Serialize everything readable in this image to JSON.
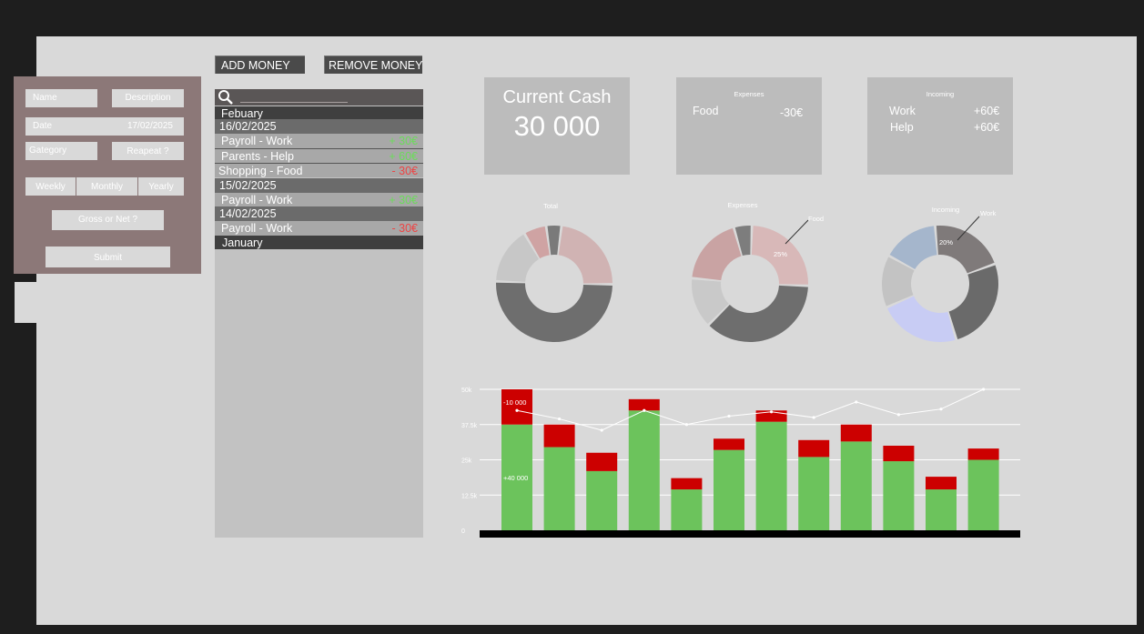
{
  "form": {
    "name_placeholder": "Name",
    "description_placeholder": "Description",
    "date_label": "Date",
    "date_value": "17/02/2025",
    "category_placeholder": "Gategory",
    "repeat_placeholder": "Reapeat ?",
    "weekly": "Weekly",
    "monthly": "Monthly",
    "yearly": "Yearly",
    "gross_or_net": "Gross or Net ?",
    "submit": "Submit"
  },
  "toolbar": {
    "add_money": "ADD MONEY",
    "remove_money": "REMOVE MONEY"
  },
  "transactions": {
    "month_feb": "Febuary",
    "month_jan": "January",
    "groups": [
      {
        "date": "16/02/2025",
        "items": [
          {
            "label": "Payroll  -  Work",
            "amount": "+ 30€",
            "sign": "pos"
          },
          {
            "label": "Parents -  Help",
            "amount": "+ 60€",
            "sign": "pos"
          },
          {
            "label": "Shopping -  Food",
            "amount": "- 30€",
            "sign": "neg"
          }
        ]
      },
      {
        "date": "15/02/2025",
        "items": [
          {
            "label": "Payroll  -  Work",
            "amount": "+ 30€",
            "sign": "pos"
          }
        ]
      },
      {
        "date": "14/02/2025",
        "items": [
          {
            "label": "Payroll  -  Work",
            "amount": "- 30€",
            "sign": "neg"
          }
        ]
      }
    ]
  },
  "cash": {
    "title": "Current Cash",
    "value": "30 000"
  },
  "expenses_card": {
    "title": "Expenses",
    "rows": [
      {
        "label": "Food",
        "value": "-30€"
      }
    ]
  },
  "incoming_card": {
    "title": "Incoming",
    "rows": [
      {
        "label": "Work",
        "value": "+60€"
      },
      {
        "label": "Help",
        "value": "+60€"
      }
    ]
  },
  "colors": {
    "green": "#6cc35c",
    "red": "#cc0000",
    "pos_text": "#6bdc5a",
    "neg_text": "#ee4444"
  },
  "chart_data": [
    {
      "type": "pie",
      "title": "Total",
      "slices": [
        {
          "value": 4,
          "color": "#7a7a7a"
        },
        {
          "value": 22,
          "color": "#d0b3b3"
        },
        {
          "value": 48,
          "color": "#6e6e6e"
        },
        {
          "value": 15,
          "color": "#c7c7c7"
        },
        {
          "value": 6,
          "color": "#cfa3a3"
        }
      ]
    },
    {
      "type": "pie",
      "title": "Expenses",
      "annotation": "Food",
      "percent_label": "25%",
      "slices": [
        {
          "value": 25,
          "color": "#d8b8b8"
        },
        {
          "value": 37,
          "color": "#6e6e6e"
        },
        {
          "value": 14,
          "color": "#c9c9c9"
        },
        {
          "value": 19,
          "color": "#c9a3a3"
        },
        {
          "value": 5,
          "color": "#7d7d7d"
        }
      ]
    },
    {
      "type": "pie",
      "title": "Incoming",
      "annotation": "Work",
      "percent_label": "20%",
      "slices": [
        {
          "value": 20,
          "color": "#7f7a7a"
        },
        {
          "value": 25,
          "color": "#6a6a6a"
        },
        {
          "value": 22,
          "color": "#c8ccf4"
        },
        {
          "value": 14,
          "color": "#c3c3c3"
        },
        {
          "value": 15,
          "color": "#a5b6cc"
        }
      ]
    },
    {
      "type": "bar",
      "stacked": true,
      "ylim": [
        0,
        50000
      ],
      "y_ticks": [
        "0",
        "12.5k",
        "25k",
        "37.5k",
        "50k"
      ],
      "grid": true,
      "series": [
        {
          "values": [
            37500,
            29500,
            21000,
            42500,
            14500,
            28500,
            38500,
            26000,
            31500,
            24500,
            14500,
            25000
          ]
        },
        {
          "values": [
            12500,
            8000,
            6500,
            4000,
            4000,
            4000,
            4000,
            6000,
            6000,
            5500,
            4500,
            4000
          ]
        }
      ],
      "line": [
        42500,
        39500,
        35500,
        42500,
        37500,
        40500,
        42000,
        40000,
        45500,
        41000,
        43000,
        50000
      ],
      "annotations": [
        "-10 000",
        "+40 000"
      ]
    }
  ]
}
